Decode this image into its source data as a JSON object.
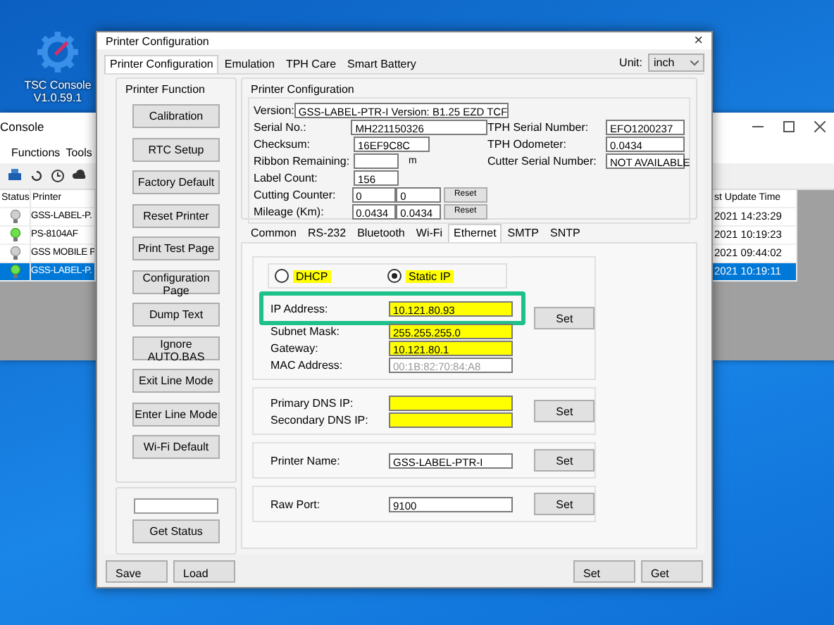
{
  "desktop_icon": {
    "label": "TSC Console",
    "version": "V1.0.59.1"
  },
  "console_window": {
    "title": "Console",
    "menu": [
      "Functions",
      "Tools"
    ],
    "table": {
      "columns": [
        "Status",
        "Printer",
        "st Update Time"
      ],
      "rows": [
        {
          "printer": "GSS-LABEL-P.",
          "updated": "2021 14:23:29",
          "online": false,
          "selected": false
        },
        {
          "printer": "PS-8104AF",
          "updated": "2021 10:19:23",
          "online": true,
          "selected": false
        },
        {
          "printer": "GSS MOBILE P",
          "updated": "2021 09:44:02",
          "online": false,
          "selected": false
        },
        {
          "printer": "GSS-LABEL-P.",
          "updated": "2021 10:19:11",
          "online": true,
          "selected": true
        }
      ]
    }
  },
  "dialog": {
    "title": "Printer Configuration",
    "close": "×",
    "tabs": [
      {
        "label": "Printer Configuration",
        "selected": true
      },
      {
        "label": "Emulation",
        "selected": false
      },
      {
        "label": "TPH Care",
        "selected": false
      },
      {
        "label": "Smart Battery",
        "selected": false
      }
    ],
    "unit": {
      "label": "Unit:",
      "value": "inch"
    },
    "printer_function": {
      "title": "Printer Function",
      "buttons": [
        "Calibration",
        "RTC Setup",
        "Factory Default",
        "Reset Printer",
        "Print Test Page",
        "Configuration Page",
        "Dump Text",
        "Ignore AUTO.BAS",
        "Exit Line Mode",
        "Enter Line Mode",
        "Wi-Fi Default"
      ],
      "status_button": "Get Status"
    },
    "printer_configuration": {
      "title": "Printer Configuration",
      "rows": [
        {
          "kind": "wide",
          "label": "Version:",
          "values": [
            "GSS-LABEL-PTR-I Version: B1.25 EZD TCF"
          ]
        },
        {
          "kind": "medium",
          "label": "Serial No.:",
          "values": [
            "MH221150326"
          ]
        },
        {
          "kind": "short",
          "label": "Checksum:",
          "values": [
            "16EF9C8C"
          ]
        },
        {
          "kind": "unit",
          "label": "Ribbon Remaining:",
          "unit": "m"
        },
        {
          "kind": "tiny",
          "label": "Label Count:",
          "values": [
            "156"
          ]
        },
        {
          "kind": "counter",
          "label": "Cutting Counter:",
          "values": [
            "0",
            "0"
          ],
          "button": "Reset"
        },
        {
          "kind": "counter",
          "label": "Mileage (Km):",
          "values": [
            "0.0434",
            "0.0434"
          ],
          "button": "Reset"
        }
      ],
      "right_rows": [
        {
          "label": "TPH Serial Number:",
          "value": "EFO1200237"
        },
        {
          "label": "TPH Odometer:",
          "value": "0.0434"
        },
        {
          "label": "Cutter Serial Number:",
          "value": "NOT AVAILABLE"
        }
      ]
    },
    "network_tabs": [
      {
        "label": "Common",
        "selected": false
      },
      {
        "label": "RS-232",
        "selected": false
      },
      {
        "label": "Bluetooth",
        "selected": false
      },
      {
        "label": "Wi-Fi",
        "selected": false
      },
      {
        "label": "Ethernet",
        "selected": true
      },
      {
        "label": "SMTP",
        "selected": false
      },
      {
        "label": "SNTP",
        "selected": false
      }
    ],
    "ethernet": {
      "modes": [
        {
          "label": "DHCP",
          "selected": false
        },
        {
          "label": "Static IP",
          "selected": true
        }
      ],
      "groups": [
        {
          "button": "Set",
          "fields": [
            {
              "label": "IP Address:",
              "value": "10.121.80.93",
              "highlighted": true,
              "outlined": true
            },
            {
              "label": "Subnet Mask:",
              "value": "255.255.255.0",
              "highlighted": true,
              "outlined": false
            },
            {
              "label": "Gateway:",
              "value": "10.121.80.1",
              "highlighted": true,
              "outlined": false
            },
            {
              "label": "MAC Address:",
              "value": "00:1B:82:70:84:A8",
              "highlighted": false,
              "disabled": true,
              "outlined": false
            }
          ]
        },
        {
          "button": "Set",
          "fields": [
            {
              "label": "Primary DNS IP:",
              "highlighted": true
            },
            {
              "label": "Secondary DNS IP:",
              "highlighted": true
            }
          ]
        },
        {
          "button": "Set",
          "fields": [
            {
              "label": "Printer Name:",
              "value": "GSS-LABEL-PTR-I",
              "highlighted": false
            }
          ]
        },
        {
          "button": "Set",
          "fields": [
            {
              "label": "Raw Port:",
              "value": "9100",
              "highlighted": false
            }
          ]
        }
      ]
    },
    "footer": {
      "left_buttons": [
        "Save",
        "Load"
      ],
      "right_buttons": [
        "Set",
        "Get"
      ]
    }
  }
}
